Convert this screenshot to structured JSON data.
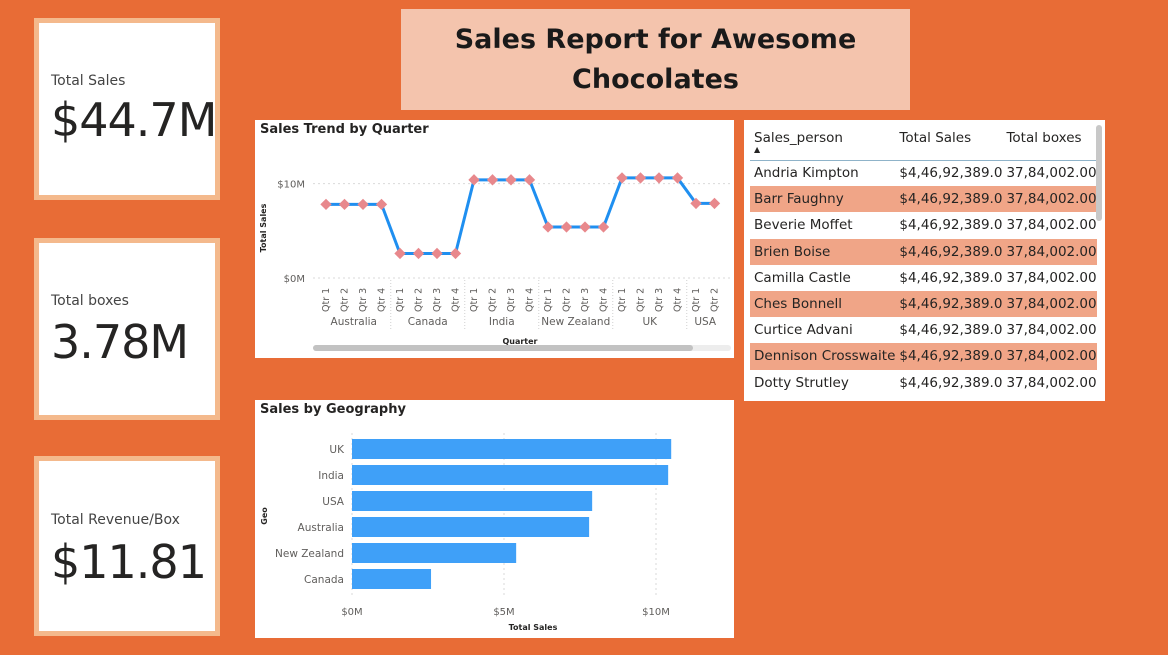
{
  "kpis": [
    {
      "label": "Total Sales",
      "value": "$44.7M"
    },
    {
      "label": "Total boxes",
      "value": "3.78M"
    },
    {
      "label": "Total Revenue/Box",
      "value": "$11.81"
    }
  ],
  "report_title": "Sales Report for Awesome Chocolates",
  "trend_chart": {
    "title": "Sales Trend by Quarter",
    "xlabel": "Quarter",
    "ylabel": "Total Sales",
    "y_ticks": [
      "$10M",
      "$0M"
    ],
    "groups": [
      {
        "name": "Australia",
        "quarters": [
          "Qtr 1",
          "Qtr 2",
          "Qtr 3",
          "Qtr 4"
        ]
      },
      {
        "name": "Canada",
        "quarters": [
          "Qtr 1",
          "Qtr 2",
          "Qtr 3",
          "Qtr 4"
        ]
      },
      {
        "name": "India",
        "quarters": [
          "Qtr 1",
          "Qtr 2",
          "Qtr 3",
          "Qtr 4"
        ]
      },
      {
        "name": "New Zealand",
        "quarters": [
          "Qtr 1",
          "Qtr 2",
          "Qtr 3",
          "Qtr 4"
        ]
      },
      {
        "name": "UK",
        "quarters": [
          "Qtr 1",
          "Qtr 2",
          "Qtr 3",
          "Qtr 4"
        ]
      },
      {
        "name": "USA",
        "quarters": [
          "Qtr 1",
          "Qtr 2"
        ]
      }
    ],
    "line_color": "#1f8ff0",
    "marker_color": "#e8888c"
  },
  "geo_chart": {
    "title": "Sales by Geography",
    "xlabel": "Total Sales",
    "ylabel": "Geo",
    "x_ticks": [
      "$0M",
      "$5M",
      "$10M"
    ],
    "bar_color": "#3fa0f8"
  },
  "chart_data": [
    {
      "type": "line",
      "title": "Sales Trend by Quarter",
      "xlabel": "Quarter",
      "ylabel": "Total Sales",
      "ylim": [
        0,
        12.5
      ],
      "unit": "$M",
      "categories": [
        "Australia Qtr 1",
        "Australia Qtr 2",
        "Australia Qtr 3",
        "Australia Qtr 4",
        "Canada Qtr 1",
        "Canada Qtr 2",
        "Canada Qtr 3",
        "Canada Qtr 4",
        "India Qtr 1",
        "India Qtr 2",
        "India Qtr 3",
        "India Qtr 4",
        "New Zealand Qtr 1",
        "New Zealand Qtr 2",
        "New Zealand Qtr 3",
        "New Zealand Qtr 4",
        "UK Qtr 1",
        "UK Qtr 2",
        "UK Qtr 3",
        "UK Qtr 4",
        "USA Qtr 1",
        "USA Qtr 2"
      ],
      "values": [
        7.8,
        7.8,
        7.8,
        7.8,
        2.6,
        2.6,
        2.6,
        2.6,
        10.4,
        10.4,
        10.4,
        10.4,
        5.4,
        5.4,
        5.4,
        5.4,
        10.6,
        10.6,
        10.6,
        10.6,
        7.9,
        7.9
      ]
    },
    {
      "type": "bar",
      "orientation": "horizontal",
      "title": "Sales by Geography",
      "xlabel": "Total Sales",
      "ylabel": "Geo",
      "xlim": [
        0,
        12
      ],
      "unit": "$M",
      "categories": [
        "UK",
        "India",
        "USA",
        "Australia",
        "New Zealand",
        "Canada"
      ],
      "values": [
        10.5,
        10.4,
        7.9,
        7.8,
        5.4,
        2.6
      ]
    }
  ],
  "table": {
    "columns": [
      "Sales_person",
      "Total Sales",
      "Total boxes"
    ],
    "rows": [
      [
        "Andria Kimpton",
        "$4,46,92,389.0",
        "37,84,002.00"
      ],
      [
        "Barr Faughny",
        "$4,46,92,389.0",
        "37,84,002.00"
      ],
      [
        "Beverie Moffet",
        "$4,46,92,389.0",
        "37,84,002.00"
      ],
      [
        "Brien Boise",
        "$4,46,92,389.0",
        "37,84,002.00"
      ],
      [
        "Camilla Castle",
        "$4,46,92,389.0",
        "37,84,002.00"
      ],
      [
        "Ches Bonnell",
        "$4,46,92,389.0",
        "37,84,002.00"
      ],
      [
        "Curtice Advani",
        "$4,46,92,389.0",
        "37,84,002.00"
      ],
      [
        "Dennison Crosswaite",
        "$4,46,92,389.0",
        "37,84,002.00"
      ],
      [
        "Dotty Strutley",
        "$4,46,92,389.0",
        "37,84,002.00"
      ]
    ],
    "row_highlight_color": "#f0a587"
  }
}
